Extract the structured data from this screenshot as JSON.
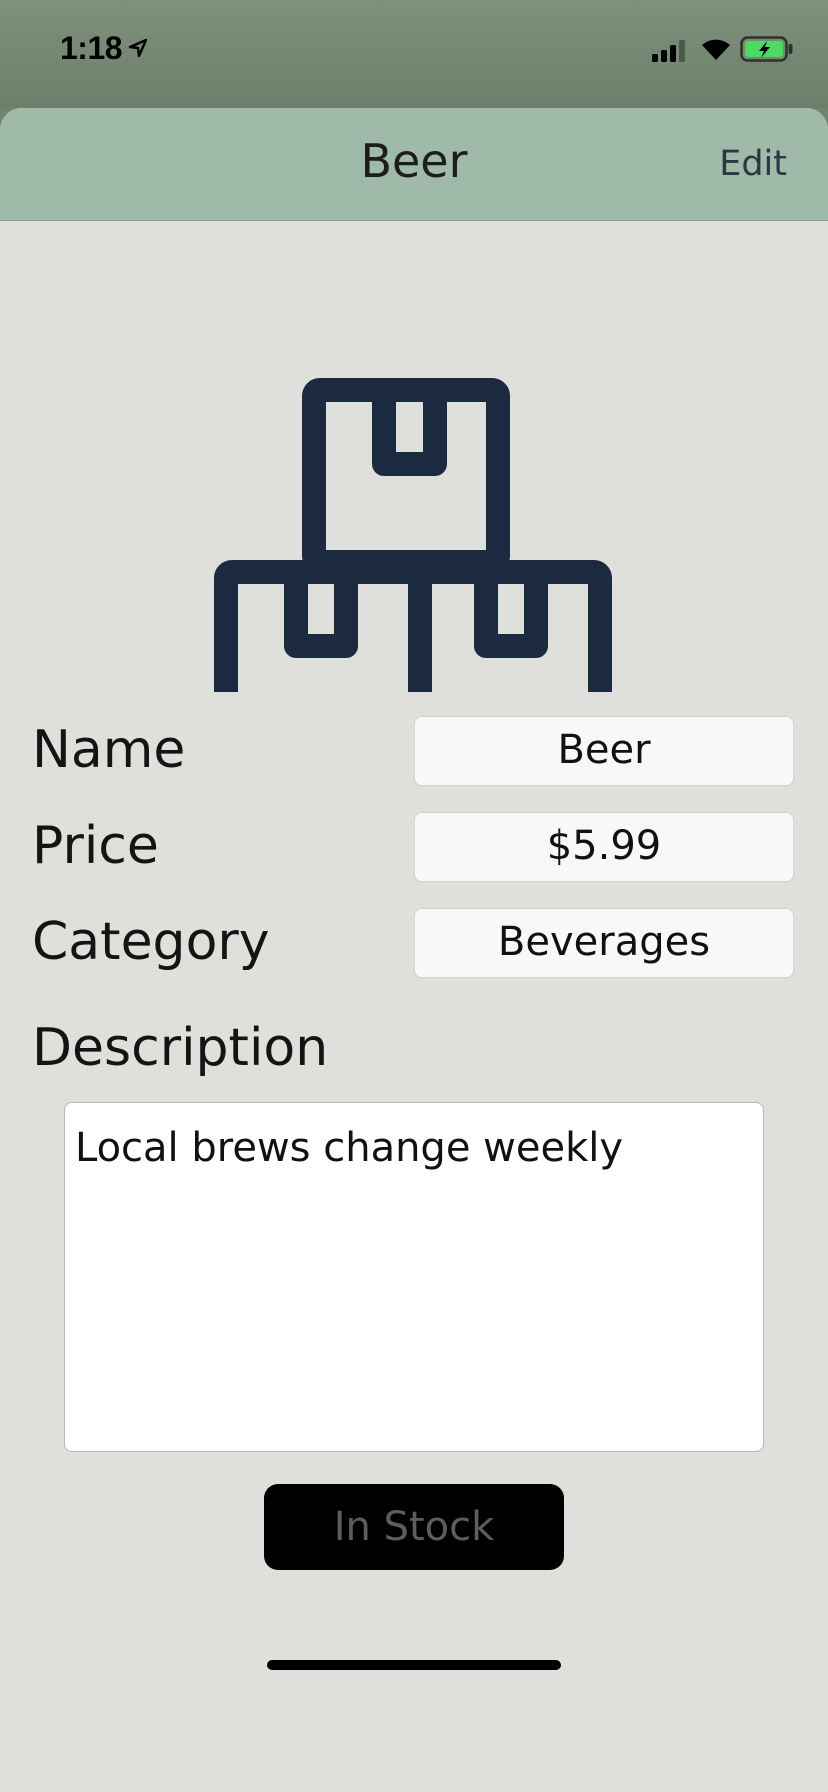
{
  "status_bar": {
    "time": "1:18",
    "icons": [
      "location-arrow-icon",
      "cellular-signal-icon",
      "wifi-icon",
      "battery-charging-icon"
    ],
    "battery_color": "#4cd964"
  },
  "nav_bar": {
    "title": "Beer",
    "edit_label": "Edit",
    "background": "#9fbaa9"
  },
  "product": {
    "image_icon": "stacked-boxes-icon",
    "icon_color": "#1c2a40",
    "fields": {
      "name_label": "Name",
      "name_value": "Beer",
      "price_label": "Price",
      "price_value": "$5.99",
      "category_label": "Category",
      "category_value": "Beverages",
      "description_label": "Description",
      "description_value": "Local brews change weekly"
    },
    "stock_button_label": "In Stock"
  }
}
